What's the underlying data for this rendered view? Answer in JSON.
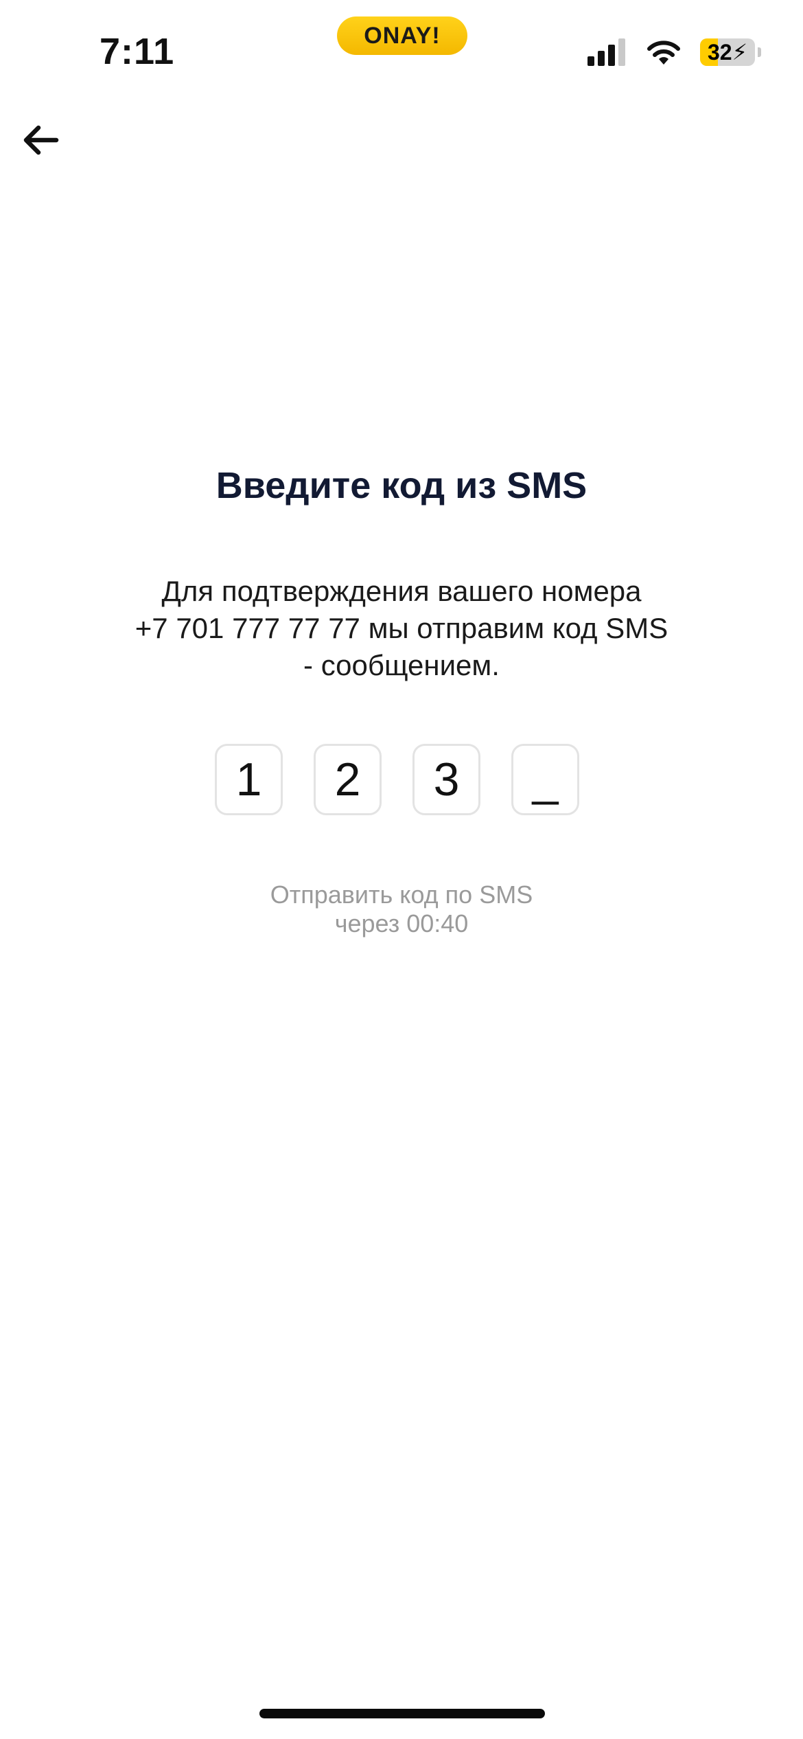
{
  "status_bar": {
    "time": "7:11",
    "brand": "ONAY!",
    "battery_percent": 32,
    "battery_label": "32",
    "signal_icon": "cellular-signal-icon",
    "wifi_icon": "wifi-icon",
    "charging_icon": "lightning-icon"
  },
  "nav": {
    "back_icon": "arrow-left-icon"
  },
  "main": {
    "title": "Введите код из SMS",
    "description_lines": [
      "Для подтверждения вашего номера",
      "+7 701 777 77 77 мы отправим код SMS",
      "- сообщением."
    ],
    "code_digits": [
      "1",
      "2",
      "3",
      "_"
    ],
    "resend_lines": [
      "Отправить код по SMS",
      "через 00:40"
    ]
  },
  "colors": {
    "brand_yellow": "#FFCC00",
    "title_text": "#121A33",
    "muted_text": "#9A9A9A",
    "code_box_border": "#E3E3E3"
  }
}
